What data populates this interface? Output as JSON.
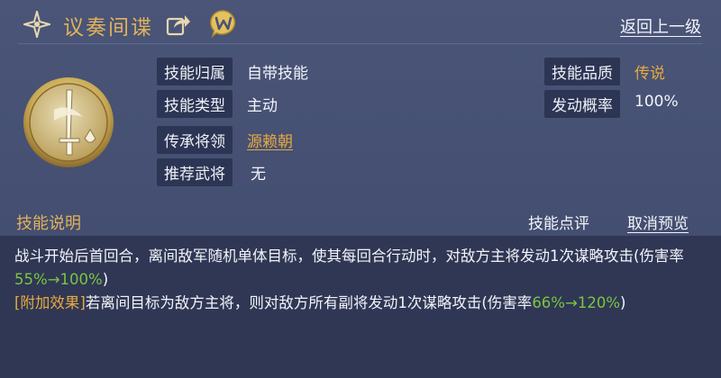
{
  "header": {
    "title": "议奏间谍",
    "back_label": "返回上一级"
  },
  "info": {
    "belong_label": "技能归属",
    "belong_value": "自带技能",
    "type_label": "技能类型",
    "type_value": "主动",
    "inherit_label": "传承将领",
    "inherit_value": "源赖朝",
    "recommend_label": "推荐武将",
    "recommend_value": "无",
    "quality_label": "技能品质",
    "quality_value": "传说",
    "rate_label": "发动概率",
    "rate_value": "100%"
  },
  "section": {
    "title": "技能说明",
    "review_label": "技能点评",
    "cancel_preview_label": "取消预览"
  },
  "description": {
    "p1_text": "战斗开始后首回合，离间敌军随机单体目标，使其每回合行动时，对敌方主将发动1次谋略攻击(伤害率",
    "p1_from": "55%",
    "p1_arrow": "→",
    "p1_to": "100%",
    "p1_end": ")",
    "p2_tag": "[附加效果]",
    "p2_text": "若离间目标为敌方主将，则对敌方所有副将发动1次谋略攻击(伤害率",
    "p2_from": "66%",
    "p2_arrow": "→",
    "p2_to": "120%",
    "p2_end": ")"
  },
  "colors": {
    "gold": "#e8a93f",
    "green": "#7cc442",
    "background": "#464f72"
  },
  "icons": {
    "title": "four-point-star-icon",
    "share": "share-icon",
    "w": "w-chat-bubble-icon",
    "skill": "sword-medallion-icon"
  }
}
